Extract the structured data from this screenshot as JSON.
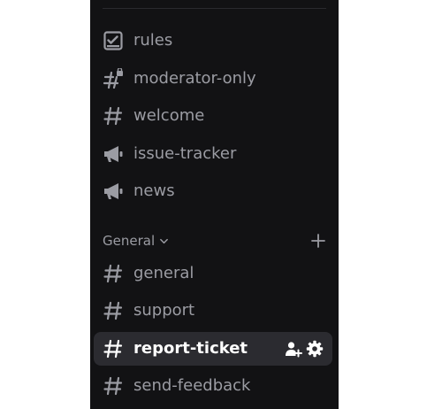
{
  "top_channels": [
    {
      "label": "rules",
      "icon": "rules-icon"
    },
    {
      "label": "moderator-only",
      "icon": "locked-hashtag-icon"
    },
    {
      "label": "welcome",
      "icon": "hashtag-icon"
    },
    {
      "label": "issue-tracker",
      "icon": "megaphone-icon"
    },
    {
      "label": "news",
      "icon": "megaphone-icon"
    }
  ],
  "category": {
    "label": "General",
    "chevron_icon": "chevron-down-icon",
    "add_icon": "plus-icon"
  },
  "category_channels": [
    {
      "label": "general",
      "icon": "hashtag-icon"
    },
    {
      "label": "support",
      "icon": "hashtag-icon"
    },
    {
      "label": "report-ticket",
      "icon": "hashtag-icon",
      "selected": true,
      "actions": [
        "add-member-icon",
        "gear-icon"
      ]
    },
    {
      "label": "send-feedback",
      "icon": "hashtag-icon"
    }
  ],
  "colors": {
    "sidebar_bg": "#121214",
    "selected_bg": "#2b2b30",
    "muted_text": "#9b9ca3",
    "active_text": "#ffffff"
  }
}
